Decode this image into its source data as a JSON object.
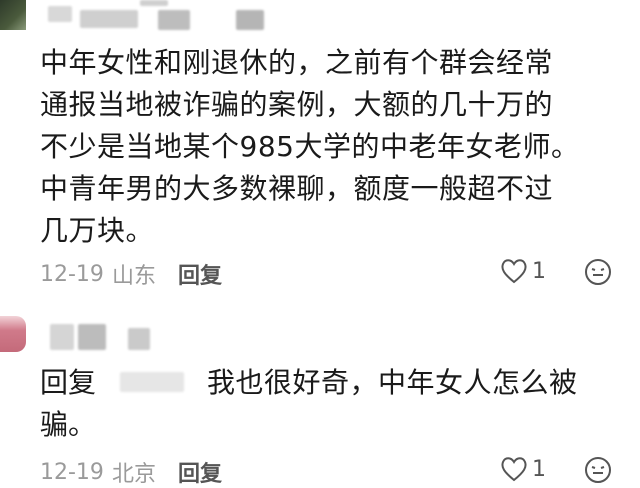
{
  "comments": [
    {
      "text_lines": [
        "中年女性和刚退休的，之前有个群会经常",
        "通报当地被诈骗的案例，大额的几十万的",
        "不少是当地某个985大学的中老年女老师。",
        "中青年男的大多数裸聊，额度一般超不过",
        "几万块。"
      ],
      "date": "12-19",
      "location": "山东",
      "reply_label": "回复",
      "likes": "1",
      "like_icon": "heart-outline-icon",
      "react_icon": "emoji-face-icon"
    },
    {
      "reply_prefix": "回复",
      "text_line1": "我也很好奇，中年女人怎么被",
      "text_line2": "骗。",
      "date": "12-19",
      "location": "北京",
      "reply_label": "回复",
      "likes": "1",
      "like_icon": "heart-outline-icon",
      "react_icon": "emoji-face-icon"
    }
  ]
}
